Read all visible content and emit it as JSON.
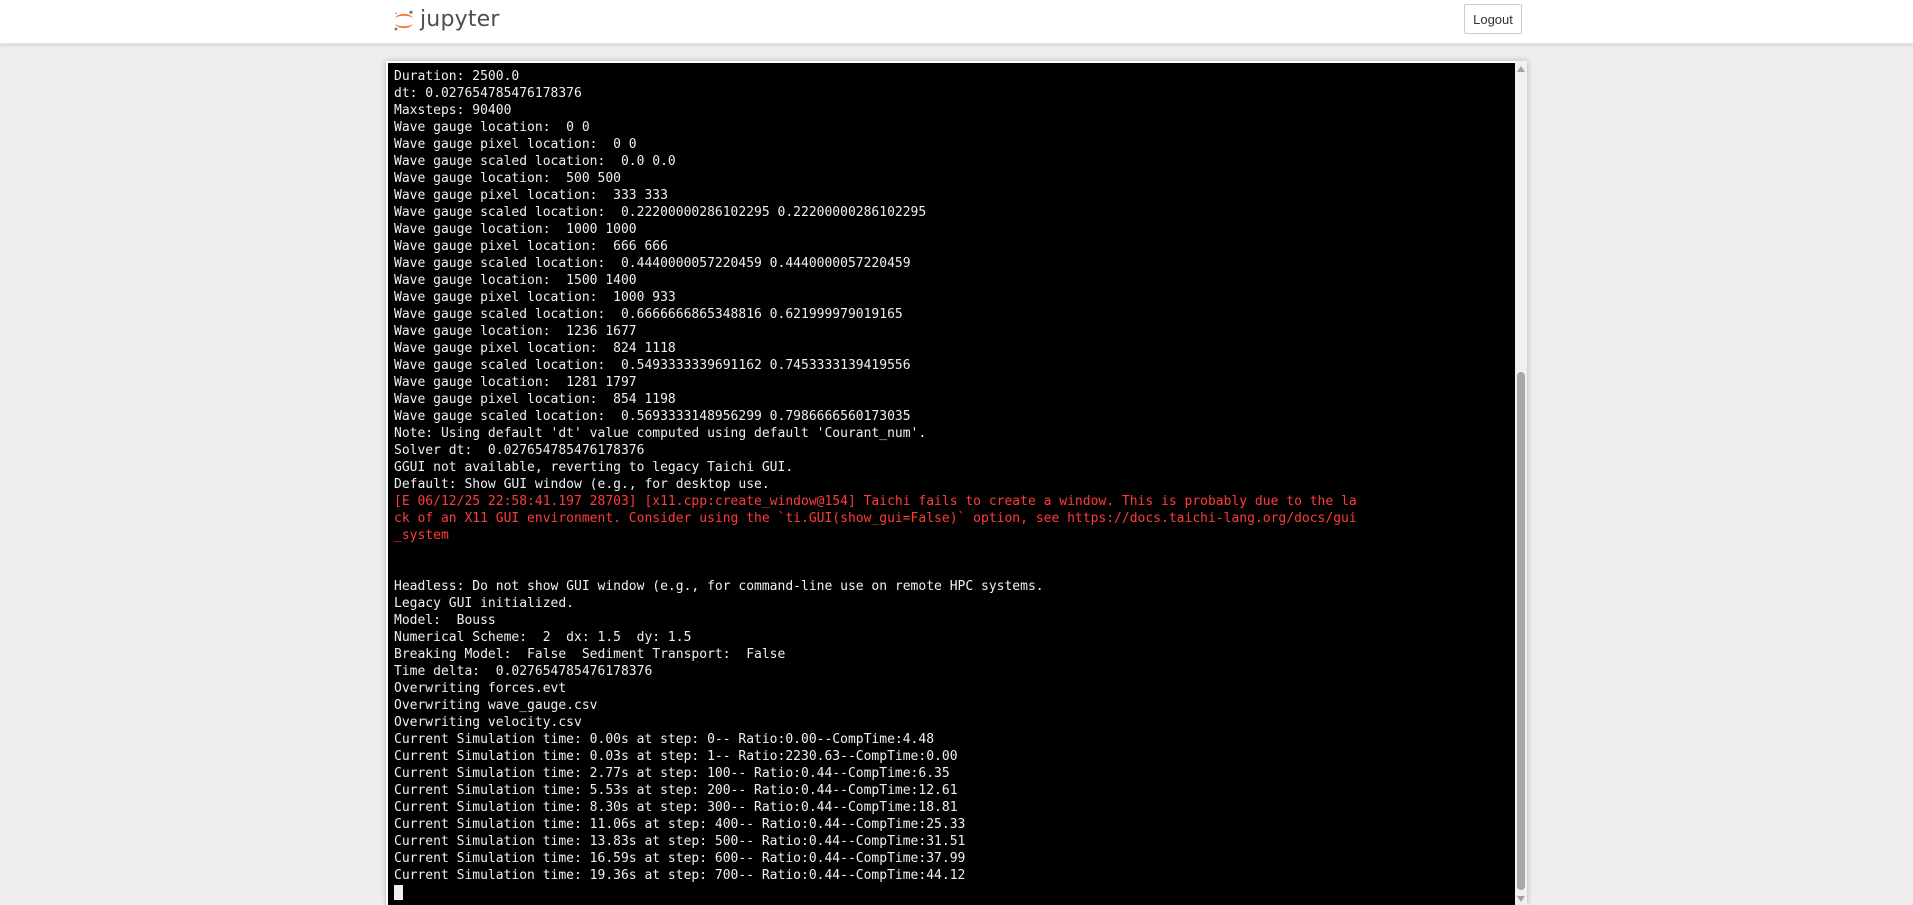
{
  "header": {
    "logo_text": "jupyter",
    "logout_label": "Logout",
    "brand_color": "#f37626"
  },
  "terminal": {
    "colors": {
      "background": "#000000",
      "text": "#f0f0f0",
      "error": "#ff3b3b"
    },
    "lines": [
      {
        "text": "Duration: 2500.0",
        "kind": "normal"
      },
      {
        "text": "dt: 0.027654785476178376",
        "kind": "normal"
      },
      {
        "text": "Maxsteps: 90400",
        "kind": "normal"
      },
      {
        "text": "Wave gauge location:  0 0",
        "kind": "normal"
      },
      {
        "text": "Wave gauge pixel location:  0 0",
        "kind": "normal"
      },
      {
        "text": "Wave gauge scaled location:  0.0 0.0",
        "kind": "normal"
      },
      {
        "text": "Wave gauge location:  500 500",
        "kind": "normal"
      },
      {
        "text": "Wave gauge pixel location:  333 333",
        "kind": "normal"
      },
      {
        "text": "Wave gauge scaled location:  0.22200000286102295 0.22200000286102295",
        "kind": "normal"
      },
      {
        "text": "Wave gauge location:  1000 1000",
        "kind": "normal"
      },
      {
        "text": "Wave gauge pixel location:  666 666",
        "kind": "normal"
      },
      {
        "text": "Wave gauge scaled location:  0.4440000057220459 0.4440000057220459",
        "kind": "normal"
      },
      {
        "text": "Wave gauge location:  1500 1400",
        "kind": "normal"
      },
      {
        "text": "Wave gauge pixel location:  1000 933",
        "kind": "normal"
      },
      {
        "text": "Wave gauge scaled location:  0.6666666865348816 0.621999979019165",
        "kind": "normal"
      },
      {
        "text": "Wave gauge location:  1236 1677",
        "kind": "normal"
      },
      {
        "text": "Wave gauge pixel location:  824 1118",
        "kind": "normal"
      },
      {
        "text": "Wave gauge scaled location:  0.5493333339691162 0.7453333139419556",
        "kind": "normal"
      },
      {
        "text": "Wave gauge location:  1281 1797",
        "kind": "normal"
      },
      {
        "text": "Wave gauge pixel location:  854 1198",
        "kind": "normal"
      },
      {
        "text": "Wave gauge scaled location:  0.5693333148956299 0.7986666560173035",
        "kind": "normal"
      },
      {
        "text": "Note: Using default 'dt' value computed using default 'Courant_num'.",
        "kind": "normal"
      },
      {
        "text": "Solver dt:  0.027654785476178376",
        "kind": "normal"
      },
      {
        "text": "GGUI not available, reverting to legacy Taichi GUI.",
        "kind": "normal"
      },
      {
        "text": "Default: Show GUI window (e.g., for desktop use.",
        "kind": "normal"
      },
      {
        "text": "[E 06/12/25 22:58:41.197 28703] [x11.cpp:create_window@154] Taichi fails to create a window. This is probably due to the la",
        "kind": "error"
      },
      {
        "text": "ck of an X11 GUI environment. Consider using the `ti.GUI(show_gui=False)` option, see https://docs.taichi-lang.org/docs/gui",
        "kind": "error"
      },
      {
        "text": "_system",
        "kind": "error"
      },
      {
        "text": "",
        "kind": "normal"
      },
      {
        "text": "",
        "kind": "normal"
      },
      {
        "text": "Headless: Do not show GUI window (e.g., for command-line use on remote HPC systems.",
        "kind": "normal"
      },
      {
        "text": "Legacy GUI initialized.",
        "kind": "normal"
      },
      {
        "text": "Model:  Bouss",
        "kind": "normal"
      },
      {
        "text": "Numerical Scheme:  2  dx: 1.5  dy: 1.5",
        "kind": "normal"
      },
      {
        "text": "Breaking Model:  False  Sediment Transport:  False",
        "kind": "normal"
      },
      {
        "text": "Time delta:  0.027654785476178376",
        "kind": "normal"
      },
      {
        "text": "Overwriting forces.evt",
        "kind": "normal"
      },
      {
        "text": "Overwriting wave_gauge.csv",
        "kind": "normal"
      },
      {
        "text": "Overwriting velocity.csv",
        "kind": "normal"
      },
      {
        "text": "Current Simulation time: 0.00s at step: 0-- Ratio:0.00--CompTime:4.48",
        "kind": "normal"
      },
      {
        "text": "Current Simulation time: 0.03s at step: 1-- Ratio:2230.63--CompTime:0.00",
        "kind": "normal"
      },
      {
        "text": "Current Simulation time: 2.77s at step: 100-- Ratio:0.44--CompTime:6.35",
        "kind": "normal"
      },
      {
        "text": "Current Simulation time: 5.53s at step: 200-- Ratio:0.44--CompTime:12.61",
        "kind": "normal"
      },
      {
        "text": "Current Simulation time: 8.30s at step: 300-- Ratio:0.44--CompTime:18.81",
        "kind": "normal"
      },
      {
        "text": "Current Simulation time: 11.06s at step: 400-- Ratio:0.44--CompTime:25.33",
        "kind": "normal"
      },
      {
        "text": "Current Simulation time: 13.83s at step: 500-- Ratio:0.44--CompTime:31.51",
        "kind": "normal"
      },
      {
        "text": "Current Simulation time: 16.59s at step: 600-- Ratio:0.44--CompTime:37.99",
        "kind": "normal"
      },
      {
        "text": "Current Simulation time: 19.36s at step: 700-- Ratio:0.44--CompTime:44.12",
        "kind": "normal"
      }
    ]
  }
}
